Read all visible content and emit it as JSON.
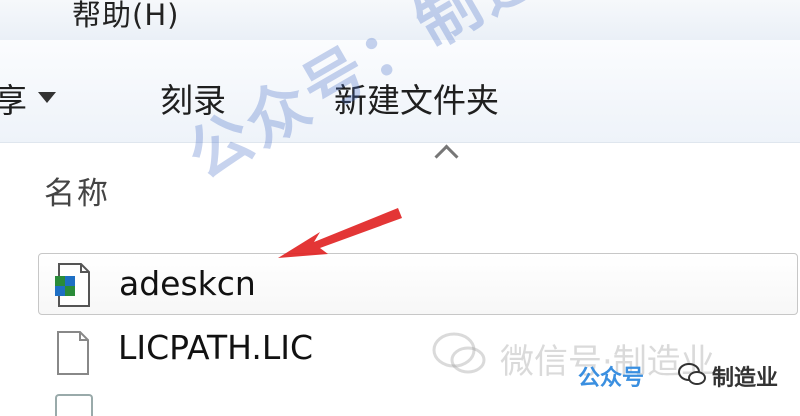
{
  "menubar": {
    "help_label": "帮助(H)",
    "left_fragment": ""
  },
  "toolbar": {
    "share_fragment": "享",
    "burn_label": "刻录",
    "new_folder_label": "新建文件夹"
  },
  "list": {
    "column_header": "名称",
    "files": [
      {
        "name": "adeskcn",
        "selected": true
      },
      {
        "name": "LICPATH.LIC",
        "selected": false
      }
    ]
  },
  "watermarks": {
    "diagonal": "公众号：制造业",
    "wechat_gray": "微信号·制造业",
    "footer_left": "公众号",
    "footer_right": "制造业"
  }
}
